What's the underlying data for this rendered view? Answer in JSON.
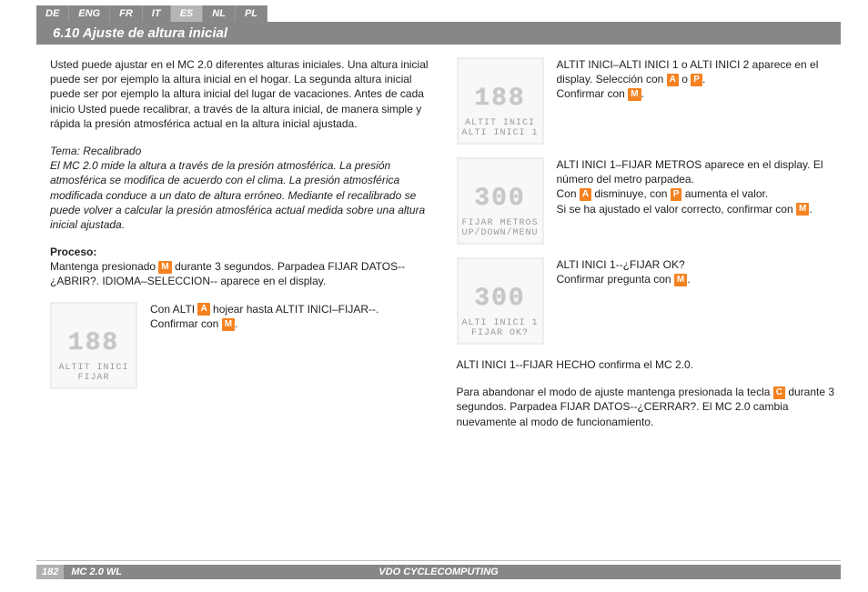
{
  "languages": [
    "DE",
    "ENG",
    "FR",
    "IT",
    "ES",
    "NL",
    "PL"
  ],
  "active_lang_index": 4,
  "title": "6.10 Ajuste de altura inicial",
  "page_num": "182",
  "model": "MC 2.0 WL",
  "brand": "VDO CYCLECOMPUTING",
  "btn": {
    "A": "A",
    "P": "P",
    "M": "M",
    "C": "C"
  },
  "lcd": {
    "altit_inici_fijar": {
      "digits": "188",
      "line1": "ALTIT INICI",
      "line2": "FIJAR"
    },
    "altit_inici_1": {
      "digits": "188",
      "line1": "ALTIT INICI",
      "line2": "ALTI INICI 1"
    },
    "fijar_metros": {
      "digits": "300",
      "line1": "FIJAR METROS",
      "line2": "UP/DOWN/MENU"
    },
    "fijar_ok": {
      "digits": "300",
      "line1": "ALTI INICI 1",
      "line2": "FIJAR OK?"
    }
  },
  "left": {
    "intro": "Usted puede ajustar en el MC 2.0 diferentes alturas iniciales. Una altura inicial puede ser por ejemplo la altura inicial en el hogar. La segunda altura inicial puede ser por ejemplo la altura inicial del lugar de vacaciones. Antes de cada inicio Usted puede recalibrar, a través de la altura inicial, de manera simple y rápida la presión atmosférica actual en la altura inicial ajustada.",
    "tema_label": "Tema: Recalibrado",
    "tema_body": "El MC 2.0 mide la altura a través de la presión atmosférica. La presión atmosférica se modifica de acuerdo con el clima. La presión atmosférica modificada conduce a un dato de altura erróneo. Mediante el recalibrado se puede volver a calcular la presión atmosférica actual medida sobre una altura inicial ajustada.",
    "proceso_label": "Proceso:",
    "proceso_1a": "Mantenga presionado ",
    "proceso_1b": " durante 3 segundos. Parpadea FIJAR DATOS--¿ABRIR?. IDIOMA–SELECCION-- aparece en el display.",
    "step_alti_a": "Con ALTI ",
    "step_alti_b": " hojear hasta ALTIT INICI–FIJAR--.",
    "confirm_pre": "Confirmar con ",
    "period": "."
  },
  "right": {
    "r1a": "ALTIT INICI–ALTI INICI 1 o ALTI INICI 2 aparece en el display. Selección con ",
    "r1b": " o ",
    "r2a": "ALTI INICI 1–FIJAR METROS aparece en el display. El número del metro parpadea.",
    "r2b_pre": "Con ",
    "r2b_mid": " disminuye, con ",
    "r2b_post": " aumenta el valor.",
    "r2c": "Si se ha ajustado el valor correcto, confirmar con ",
    "r3a": "ALTI INICI 1--¿FIJAR OK?",
    "r3b": "Confirmar pregunta con ",
    "done": "ALTI INICI 1--FIJAR HECHO confirma el MC 2.0.",
    "exit_a": "Para abandonar el modo de ajuste mantenga presionada la tecla ",
    "exit_b": " durante 3 segundos. Parpadea FIJAR DATOS--¿CERRAR?. El MC 2.0 cambia nuevamente al modo de funcionamiento."
  }
}
